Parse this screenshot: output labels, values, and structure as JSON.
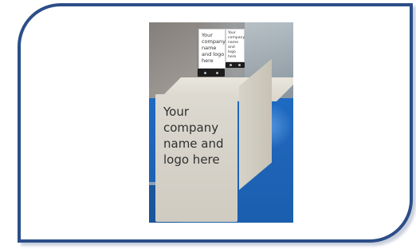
{
  "colors": {
    "frame_border": "#2c4e88",
    "background": "#ffffff",
    "floor_blue": "#1f64b8",
    "table_white": "#dcd9d0"
  },
  "photo": {
    "table_text": "Your\ncompany\nname and\nlogo here",
    "sign_large_text": "Your\ncompany\nname\nand logo\nhere",
    "sign_small_text": "Your\ncompany\nname and\nlogo here"
  }
}
